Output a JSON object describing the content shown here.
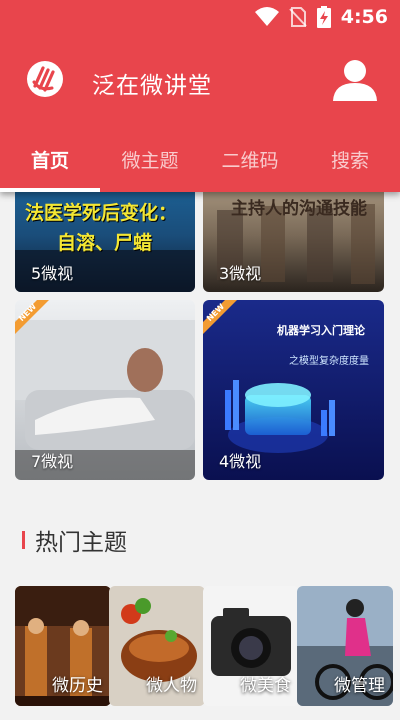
{
  "status": {
    "time": "4:56"
  },
  "header": {
    "title": "泛在微讲堂"
  },
  "tabs": [
    {
      "label": "首页",
      "active": true
    },
    {
      "label": "微主题",
      "active": false
    },
    {
      "label": "二维码",
      "active": false
    },
    {
      "label": "搜索",
      "active": false
    }
  ],
  "cards": [
    {
      "title_line1": "法医学死后变化：",
      "title_line2": "自溶、尸蜡",
      "count": "5微视"
    },
    {
      "title": "主持人的沟通技能",
      "count": "3微视"
    },
    {
      "badge": "NEW",
      "count": "7微视"
    },
    {
      "badge": "NEW",
      "title_line1": "机器学习入门理论",
      "title_line2": "之模型复杂度度量",
      "count": "4微视"
    }
  ],
  "section": {
    "title": "热门主题"
  },
  "topics": [
    {
      "label": "微历史"
    },
    {
      "label": "微人物"
    },
    {
      "label": "微美食"
    },
    {
      "label": "微管理"
    }
  ],
  "colors": {
    "accent": "#e8454c"
  }
}
